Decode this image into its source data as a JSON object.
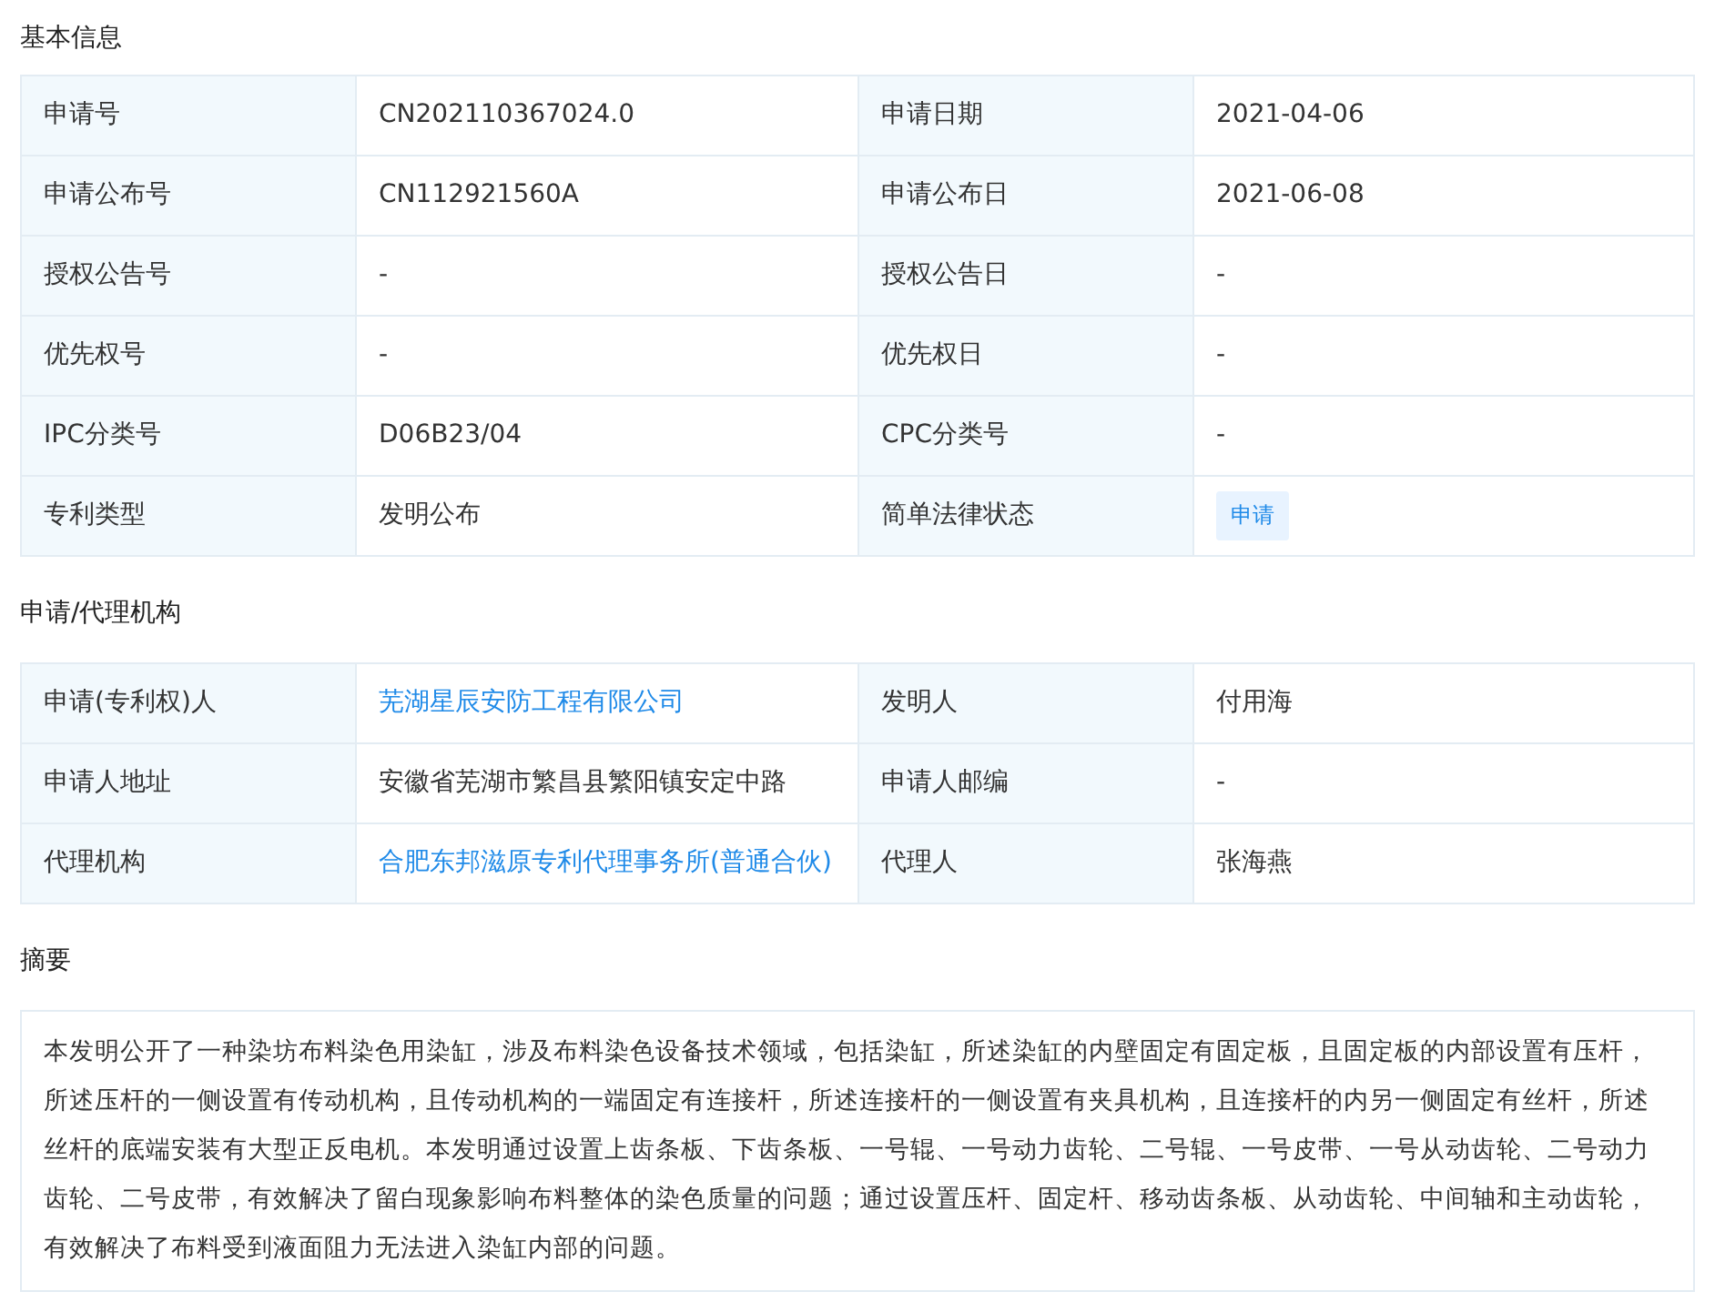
{
  "sections": [
    {
      "title": "基本信息",
      "kind": "table",
      "rows": [
        [
          {
            "kind": "label",
            "text": "申请号"
          },
          {
            "kind": "text",
            "text": "CN202110367024.0"
          },
          {
            "kind": "label",
            "text": "申请日期"
          },
          {
            "kind": "text",
            "text": "2021-04-06"
          }
        ],
        [
          {
            "kind": "label",
            "text": "申请公布号"
          },
          {
            "kind": "text",
            "text": "CN112921560A"
          },
          {
            "kind": "label",
            "text": "申请公布日"
          },
          {
            "kind": "text",
            "text": "2021-06-08"
          }
        ],
        [
          {
            "kind": "label",
            "text": "授权公告号"
          },
          {
            "kind": "text",
            "text": "-"
          },
          {
            "kind": "label",
            "text": "授权公告日"
          },
          {
            "kind": "text",
            "text": "-"
          }
        ],
        [
          {
            "kind": "label",
            "text": "优先权号"
          },
          {
            "kind": "text",
            "text": "-"
          },
          {
            "kind": "label",
            "text": "优先权日"
          },
          {
            "kind": "text",
            "text": "-"
          }
        ],
        [
          {
            "kind": "label",
            "text": "IPC分类号"
          },
          {
            "kind": "text",
            "text": "D06B23/04"
          },
          {
            "kind": "label",
            "text": "CPC分类号"
          },
          {
            "kind": "text",
            "text": "-"
          }
        ],
        [
          {
            "kind": "label",
            "text": "专利类型"
          },
          {
            "kind": "text",
            "text": "发明公布"
          },
          {
            "kind": "label",
            "text": "简单法律状态"
          },
          {
            "kind": "tag",
            "text": "申请"
          }
        ]
      ]
    },
    {
      "title": "申请/代理机构",
      "kind": "table",
      "rows": [
        [
          {
            "kind": "label",
            "text": "申请(专利权)人"
          },
          {
            "kind": "link",
            "text": "芜湖星辰安防工程有限公司"
          },
          {
            "kind": "label",
            "text": "发明人"
          },
          {
            "kind": "text",
            "text": "付用海"
          }
        ],
        [
          {
            "kind": "label",
            "text": "申请人地址"
          },
          {
            "kind": "text",
            "text": "安徽省芜湖市繁昌县繁阳镇安定中路"
          },
          {
            "kind": "label",
            "text": "申请人邮编"
          },
          {
            "kind": "text",
            "text": "-"
          }
        ],
        [
          {
            "kind": "label",
            "text": "代理机构"
          },
          {
            "kind": "link",
            "text": "合肥东邦滋原专利代理事务所(普通合伙)"
          },
          {
            "kind": "label",
            "text": "代理人"
          },
          {
            "kind": "text",
            "text": "张海燕"
          }
        ]
      ]
    },
    {
      "title": "摘要",
      "kind": "text",
      "body": "本发明公开了一种染坊布料染色用染缸，涉及布料染色设备技术领域，包括染缸，所述染缸的内壁固定有固定板，且固定板的内部设置有压杆，所述压杆的一侧设置有传动机构，且传动机构的一端固定有连接杆，所述连接杆的一侧设置有夹具机构，且连接杆的内另一侧固定有丝杆，所述丝杆的底端安装有大型正反电机。本发明通过设置上齿条板、下齿条板、一号辊、一号动力齿轮、二号辊、一号皮带、一号从动齿轮、二号动力齿轮、二号皮带，有效解决了留白现象影响布料整体的染色质量的问题；通过设置压杆、固定杆、移动齿条板、从动齿轮、中间轴和主动齿轮，有效解决了布料受到液面阻力无法进入染缸内部的问题。"
    }
  ]
}
